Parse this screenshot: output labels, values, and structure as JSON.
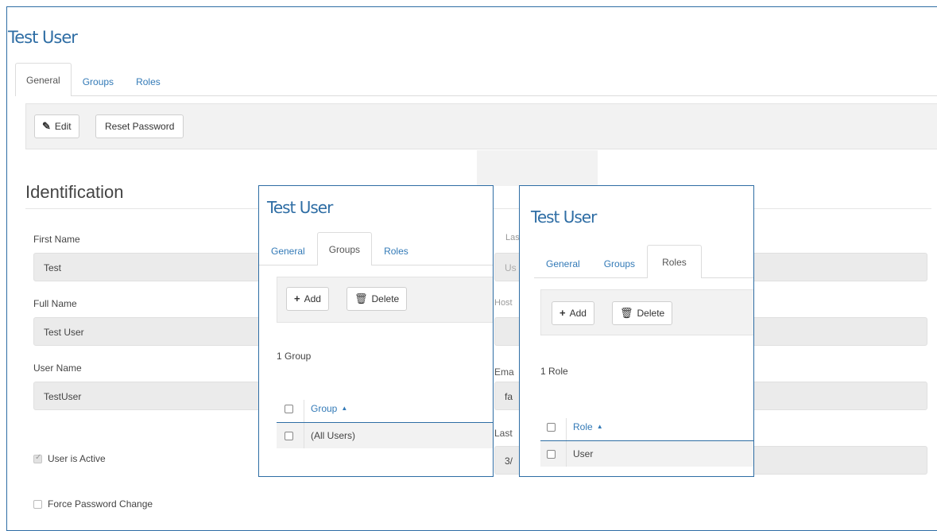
{
  "main": {
    "title": "Test User",
    "tabs": [
      {
        "label": "General"
      },
      {
        "label": "Groups"
      },
      {
        "label": "Roles"
      }
    ],
    "toolbar": {
      "edit_icon": "edit-icon",
      "edit_label": "Edit",
      "reset_label": "Reset Password"
    },
    "section_title": "Identification",
    "fields": {
      "first_name": {
        "label": "First Name",
        "value": "Test"
      },
      "full_name": {
        "label": "Full Name",
        "value": "Test User"
      },
      "user_name": {
        "label": "User Name",
        "value": "TestUser"
      }
    },
    "checkboxes": {
      "user_active": {
        "label": "User is Active",
        "checked": true
      },
      "force_pw": {
        "label": "Force Password Change",
        "checked": false
      }
    },
    "partial_right": {
      "last_label": "Last",
      "us_value": "Us",
      "host_label": "Host",
      "email_label": "Ema",
      "fa_value": "fa",
      "last2_label": "Last",
      "date_value": "3/"
    }
  },
  "groups_popup": {
    "title": "Test User",
    "tabs": [
      {
        "label": "General"
      },
      {
        "label": "Groups"
      },
      {
        "label": "Roles"
      }
    ],
    "add_label": "Add",
    "delete_label": "Delete",
    "count": "1 Group",
    "column": "Group",
    "rows": [
      "(All Users)"
    ]
  },
  "roles_popup": {
    "title": "Test User",
    "tabs": [
      {
        "label": "General"
      },
      {
        "label": "Groups"
      },
      {
        "label": "Roles"
      }
    ],
    "add_label": "Add",
    "delete_label": "Delete",
    "count": "1 Role",
    "column": "Role",
    "rows": [
      "User"
    ]
  },
  "colors": {
    "accent": "#2e6da4",
    "link": "#337ab7"
  },
  "icons": {
    "add": "plus-icon",
    "delete": "trash-icon",
    "sort": "sort-up-icon",
    "edit": "edit-icon"
  }
}
